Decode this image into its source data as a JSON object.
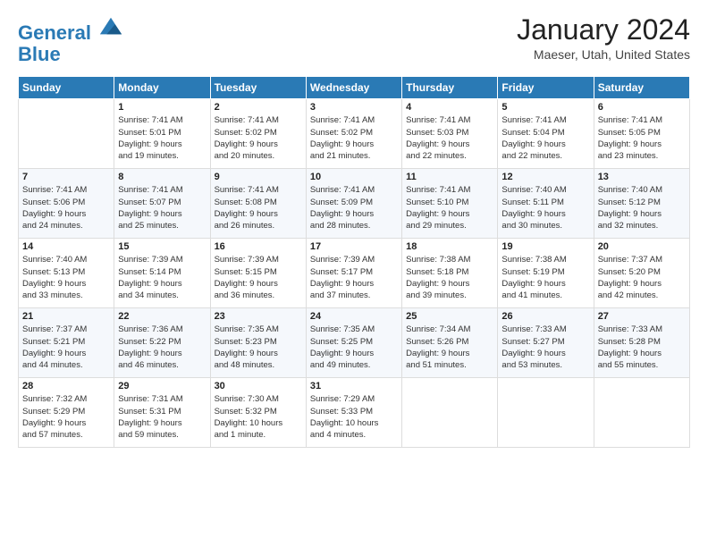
{
  "header": {
    "logo_line1": "General",
    "logo_line2": "Blue",
    "title": "January 2024",
    "subtitle": "Maeser, Utah, United States"
  },
  "days_of_week": [
    "Sunday",
    "Monday",
    "Tuesday",
    "Wednesday",
    "Thursday",
    "Friday",
    "Saturday"
  ],
  "weeks": [
    [
      {
        "day": "",
        "lines": []
      },
      {
        "day": "1",
        "lines": [
          "Sunrise: 7:41 AM",
          "Sunset: 5:01 PM",
          "Daylight: 9 hours",
          "and 19 minutes."
        ]
      },
      {
        "day": "2",
        "lines": [
          "Sunrise: 7:41 AM",
          "Sunset: 5:02 PM",
          "Daylight: 9 hours",
          "and 20 minutes."
        ]
      },
      {
        "day": "3",
        "lines": [
          "Sunrise: 7:41 AM",
          "Sunset: 5:02 PM",
          "Daylight: 9 hours",
          "and 21 minutes."
        ]
      },
      {
        "day": "4",
        "lines": [
          "Sunrise: 7:41 AM",
          "Sunset: 5:03 PM",
          "Daylight: 9 hours",
          "and 22 minutes."
        ]
      },
      {
        "day": "5",
        "lines": [
          "Sunrise: 7:41 AM",
          "Sunset: 5:04 PM",
          "Daylight: 9 hours",
          "and 22 minutes."
        ]
      },
      {
        "day": "6",
        "lines": [
          "Sunrise: 7:41 AM",
          "Sunset: 5:05 PM",
          "Daylight: 9 hours",
          "and 23 minutes."
        ]
      }
    ],
    [
      {
        "day": "7",
        "lines": [
          "Sunrise: 7:41 AM",
          "Sunset: 5:06 PM",
          "Daylight: 9 hours",
          "and 24 minutes."
        ]
      },
      {
        "day": "8",
        "lines": [
          "Sunrise: 7:41 AM",
          "Sunset: 5:07 PM",
          "Daylight: 9 hours",
          "and 25 minutes."
        ]
      },
      {
        "day": "9",
        "lines": [
          "Sunrise: 7:41 AM",
          "Sunset: 5:08 PM",
          "Daylight: 9 hours",
          "and 26 minutes."
        ]
      },
      {
        "day": "10",
        "lines": [
          "Sunrise: 7:41 AM",
          "Sunset: 5:09 PM",
          "Daylight: 9 hours",
          "and 28 minutes."
        ]
      },
      {
        "day": "11",
        "lines": [
          "Sunrise: 7:41 AM",
          "Sunset: 5:10 PM",
          "Daylight: 9 hours",
          "and 29 minutes."
        ]
      },
      {
        "day": "12",
        "lines": [
          "Sunrise: 7:40 AM",
          "Sunset: 5:11 PM",
          "Daylight: 9 hours",
          "and 30 minutes."
        ]
      },
      {
        "day": "13",
        "lines": [
          "Sunrise: 7:40 AM",
          "Sunset: 5:12 PM",
          "Daylight: 9 hours",
          "and 32 minutes."
        ]
      }
    ],
    [
      {
        "day": "14",
        "lines": [
          "Sunrise: 7:40 AM",
          "Sunset: 5:13 PM",
          "Daylight: 9 hours",
          "and 33 minutes."
        ]
      },
      {
        "day": "15",
        "lines": [
          "Sunrise: 7:39 AM",
          "Sunset: 5:14 PM",
          "Daylight: 9 hours",
          "and 34 minutes."
        ]
      },
      {
        "day": "16",
        "lines": [
          "Sunrise: 7:39 AM",
          "Sunset: 5:15 PM",
          "Daylight: 9 hours",
          "and 36 minutes."
        ]
      },
      {
        "day": "17",
        "lines": [
          "Sunrise: 7:39 AM",
          "Sunset: 5:17 PM",
          "Daylight: 9 hours",
          "and 37 minutes."
        ]
      },
      {
        "day": "18",
        "lines": [
          "Sunrise: 7:38 AM",
          "Sunset: 5:18 PM",
          "Daylight: 9 hours",
          "and 39 minutes."
        ]
      },
      {
        "day": "19",
        "lines": [
          "Sunrise: 7:38 AM",
          "Sunset: 5:19 PM",
          "Daylight: 9 hours",
          "and 41 minutes."
        ]
      },
      {
        "day": "20",
        "lines": [
          "Sunrise: 7:37 AM",
          "Sunset: 5:20 PM",
          "Daylight: 9 hours",
          "and 42 minutes."
        ]
      }
    ],
    [
      {
        "day": "21",
        "lines": [
          "Sunrise: 7:37 AM",
          "Sunset: 5:21 PM",
          "Daylight: 9 hours",
          "and 44 minutes."
        ]
      },
      {
        "day": "22",
        "lines": [
          "Sunrise: 7:36 AM",
          "Sunset: 5:22 PM",
          "Daylight: 9 hours",
          "and 46 minutes."
        ]
      },
      {
        "day": "23",
        "lines": [
          "Sunrise: 7:35 AM",
          "Sunset: 5:23 PM",
          "Daylight: 9 hours",
          "and 48 minutes."
        ]
      },
      {
        "day": "24",
        "lines": [
          "Sunrise: 7:35 AM",
          "Sunset: 5:25 PM",
          "Daylight: 9 hours",
          "and 49 minutes."
        ]
      },
      {
        "day": "25",
        "lines": [
          "Sunrise: 7:34 AM",
          "Sunset: 5:26 PM",
          "Daylight: 9 hours",
          "and 51 minutes."
        ]
      },
      {
        "day": "26",
        "lines": [
          "Sunrise: 7:33 AM",
          "Sunset: 5:27 PM",
          "Daylight: 9 hours",
          "and 53 minutes."
        ]
      },
      {
        "day": "27",
        "lines": [
          "Sunrise: 7:33 AM",
          "Sunset: 5:28 PM",
          "Daylight: 9 hours",
          "and 55 minutes."
        ]
      }
    ],
    [
      {
        "day": "28",
        "lines": [
          "Sunrise: 7:32 AM",
          "Sunset: 5:29 PM",
          "Daylight: 9 hours",
          "and 57 minutes."
        ]
      },
      {
        "day": "29",
        "lines": [
          "Sunrise: 7:31 AM",
          "Sunset: 5:31 PM",
          "Daylight: 9 hours",
          "and 59 minutes."
        ]
      },
      {
        "day": "30",
        "lines": [
          "Sunrise: 7:30 AM",
          "Sunset: 5:32 PM",
          "Daylight: 10 hours",
          "and 1 minute."
        ]
      },
      {
        "day": "31",
        "lines": [
          "Sunrise: 7:29 AM",
          "Sunset: 5:33 PM",
          "Daylight: 10 hours",
          "and 4 minutes."
        ]
      },
      {
        "day": "",
        "lines": []
      },
      {
        "day": "",
        "lines": []
      },
      {
        "day": "",
        "lines": []
      }
    ]
  ]
}
